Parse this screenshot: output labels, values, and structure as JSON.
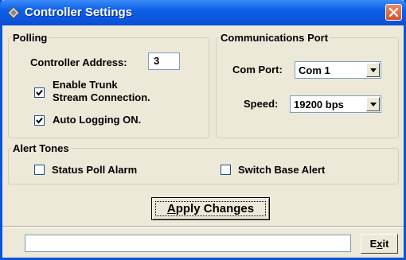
{
  "window": {
    "title": "Controller Settings",
    "title_icon": "wrench-gear-icon",
    "close_icon": "close-icon"
  },
  "polling": {
    "legend": "Polling",
    "controller_address_label": "Controller Address:",
    "controller_address_value": "3",
    "enable_trunk_line1": "Enable Trunk",
    "enable_trunk_line2": "Stream Connection.",
    "enable_trunk_checked": true,
    "auto_logging_label": "Auto Logging ON.",
    "auto_logging_checked": true
  },
  "comm_port": {
    "legend": "Communications Port",
    "com_port_label": "Com Port:",
    "com_port_value": "Com 1",
    "speed_label": "Speed:",
    "speed_value": "19200 bps"
  },
  "alert_tones": {
    "legend": "Alert Tones",
    "status_poll_label": "Status Poll Alarm",
    "status_poll_checked": false,
    "switch_base_label": "Switch Base Alert",
    "switch_base_checked": false
  },
  "apply_button": {
    "label_prefix": "",
    "label_underlined": "A",
    "label_rest": "pply Changes"
  },
  "status_bar": {
    "value": ""
  },
  "exit_button": {
    "label_prefix": "E",
    "label_underlined": "x",
    "label_rest": "it"
  },
  "colors": {
    "titlebar": "#0a55d8",
    "face": "#ece9d8",
    "close": "#d6532f"
  }
}
